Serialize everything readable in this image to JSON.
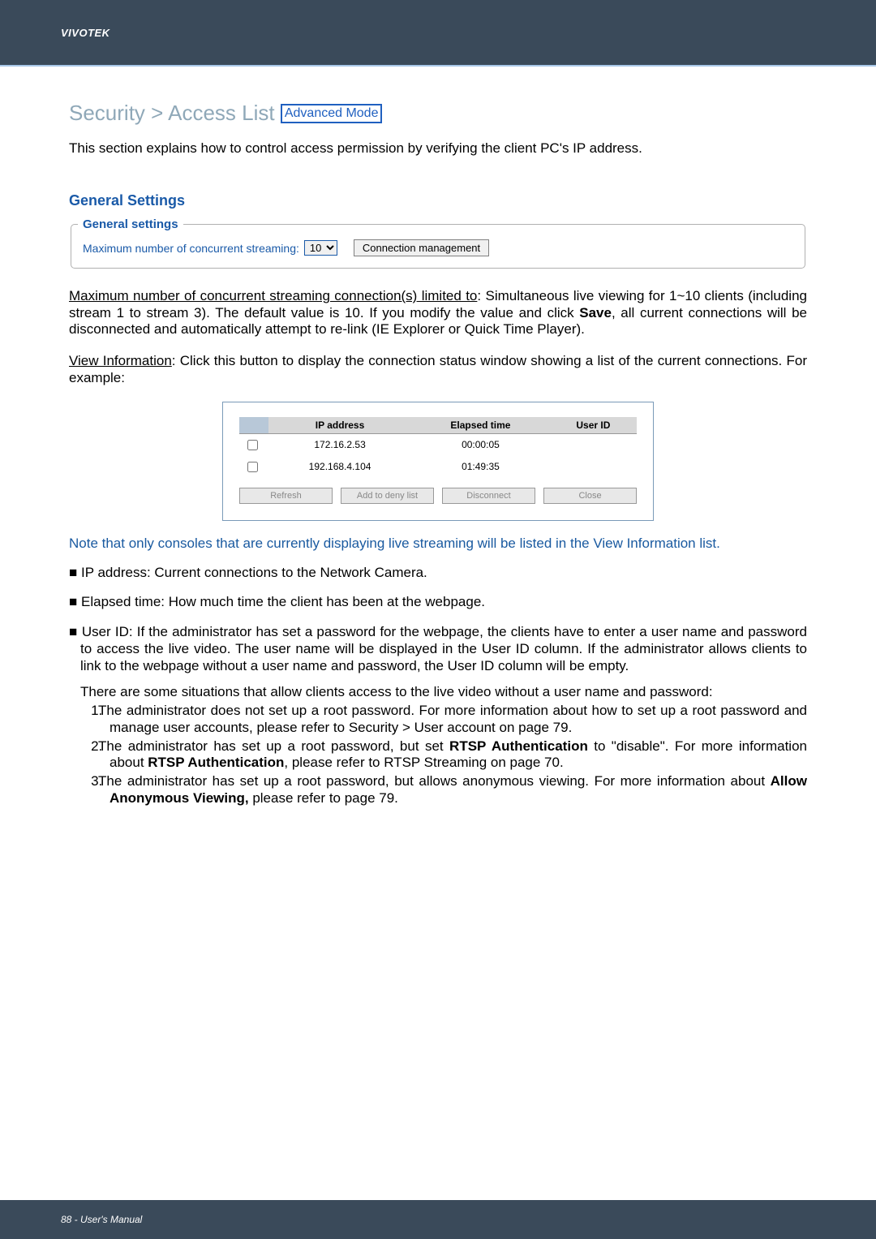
{
  "header": {
    "brand": "VIVOTEK"
  },
  "title": {
    "prefix": "Security >  Access List",
    "badge": "Advanced Mode"
  },
  "intro": "This section explains how to control access permission by verifying the client PC's IP address.",
  "general_section_heading": "General Settings",
  "general_box": {
    "legend": "General settings",
    "max_label": "Maximum number of concurrent streaming:",
    "max_value": "10",
    "btn": "Connection management"
  },
  "para_max": {
    "lead": "Maximum number of concurrent streaming connection(s) limited to",
    "rest": ": Simultaneous live viewing for 1~10 clients (including stream 1 to stream 3). The default value is 10. If you modify the value and click ",
    "save_word": "Save",
    "tail": ", all current connections will be disconnected and automatically attempt to re-link (IE Explorer or Quick Time Player)."
  },
  "para_view": {
    "lead": "View Information",
    "rest": ": Click this button to display the connection status window showing a list of the current connections. For example:"
  },
  "conn_table": {
    "headers": [
      "",
      "IP address",
      "Elapsed time",
      "User ID"
    ],
    "rows": [
      {
        "ip": "172.16.2.53",
        "elapsed": "00:00:05",
        "uid": ""
      },
      {
        "ip": "192.168.4.104",
        "elapsed": "01:49:35",
        "uid": ""
      }
    ],
    "buttons": [
      "Refresh",
      "Add to deny list",
      "Disconnect",
      "Close"
    ]
  },
  "note_blue": "Note that only consoles that are currently displaying live streaming will be listed in the View Information list.",
  "bullets": {
    "ip": "IP address: Current connections to the Network Camera.",
    "elapsed": "Elapsed time: How much time the client has been at the webpage.",
    "uid": "User ID: If the administrator has set a password for the webpage, the clients have to enter a user name and password to access the live video. The user name will be displayed in the User ID column. If  the administrator allows clients to link to the webpage without a user name and password, the User ID column will be empty."
  },
  "situations_lead": "There are some situations that allow clients access to the live video without a user name and password:",
  "situations": {
    "s1": "The administrator does not set up a root password. For more information about how to set up a root password and manage user accounts, please refer to Security > User account on page 79.",
    "s2_a": "The administrator has set up a root password, but set ",
    "s2_b": "RTSP Authentication",
    "s2_c": " to \"disable\". For more information about ",
    "s2_d": "RTSP Authentication",
    "s2_e": ", please refer to RTSP Streaming on page 70.",
    "s3_a": "The administrator has set up a root password, but allows anonymous viewing. For more information about ",
    "s3_b": "Allow Anonymous Viewing,",
    "s3_c": " please refer to page 79."
  },
  "footer": {
    "page": "88 - User's Manual"
  }
}
